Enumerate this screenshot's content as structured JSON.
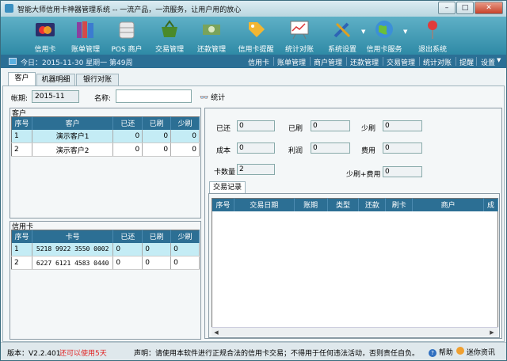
{
  "window": {
    "title": "智能大师信用卡神器管理系统 -- 一流产品，一流服务，让用户用的放心",
    "min": "–",
    "max": "□",
    "close": "✕"
  },
  "toolbar": [
    {
      "label": "信用卡",
      "icon": "credit-card-icon"
    },
    {
      "label": "账单管理",
      "icon": "books-icon"
    },
    {
      "label": "POS 商户",
      "icon": "database-icon"
    },
    {
      "label": "交易管理",
      "icon": "basket-icon"
    },
    {
      "label": "还款管理",
      "icon": "cash-icon"
    },
    {
      "label": "信用卡提醒",
      "icon": "tag-icon"
    },
    {
      "label": "统计对账",
      "icon": "chart-board-icon"
    },
    {
      "label": "系统设置",
      "icon": "tools-icon"
    },
    {
      "label": "信用卡服务",
      "icon": "globe-icon"
    },
    {
      "label": "退出系统",
      "icon": "pin-icon"
    }
  ],
  "navbar": {
    "date": "今日：2015-11-30 星期一 第49周",
    "items": [
      "信用卡",
      "账单管理",
      "商户管理",
      "还款管理",
      "交易管理",
      "统计对账",
      "提醒",
      "设置"
    ]
  },
  "tabs": [
    "客户",
    "机器明细",
    "银行对账"
  ],
  "filter": {
    "period_label": "帐期:",
    "period_value": "2015-11",
    "name_label": "名称:",
    "name_value": "",
    "stat_button": "统计"
  },
  "customers": {
    "title": "客户",
    "headers": [
      "序号",
      "客户",
      "已还",
      "已刷",
      "少刷"
    ],
    "rows": [
      [
        "1",
        "演示客户1",
        "0",
        "0",
        "0"
      ],
      [
        "2",
        "演示客户2",
        "0",
        "0",
        "0"
      ]
    ]
  },
  "cards": {
    "title": "信用卡",
    "headers": [
      "序号",
      "卡号",
      "已还",
      "已刷",
      "少刷"
    ],
    "rows": [
      [
        "1",
        "5218 9922 3550 0002",
        "0",
        "0",
        "0"
      ],
      [
        "2",
        "6227 6121 4583 0440",
        "0",
        "0",
        "0"
      ]
    ]
  },
  "summary": {
    "repaid_label": "已还",
    "repaid": "0",
    "swiped_label": "已刷",
    "swiped": "0",
    "short_label": "少刷",
    "short": "0",
    "cost_label": "成本",
    "cost": "0",
    "profit_label": "利润",
    "profit": "0",
    "fee_label": "费用",
    "fee": "0",
    "cardcount_label": "卡数量",
    "cardcount": "2",
    "shortfee_label": "少刷+费用",
    "shortfee": "0"
  },
  "transactions": {
    "tab": "交易记录",
    "headers": [
      "序号",
      "交易日期",
      "账期",
      "类型",
      "还款",
      "刷卡",
      "商户",
      "成"
    ]
  },
  "status": {
    "version": "版本：V2.2.401",
    "trial": "还可以使用5天",
    "notice": "声明：请使用本软件进行正规合法的信用卡交易；不得用于任何违法活动，否则责任自负。",
    "help": "帮助",
    "about": "迷你资讯"
  },
  "colors": {
    "toolbar": "#3f9bb6",
    "navbar": "#2b6f95",
    "grid_header": "#2c6f94",
    "selected_row": "#c4ecf5",
    "trial_text": "#e02020"
  }
}
